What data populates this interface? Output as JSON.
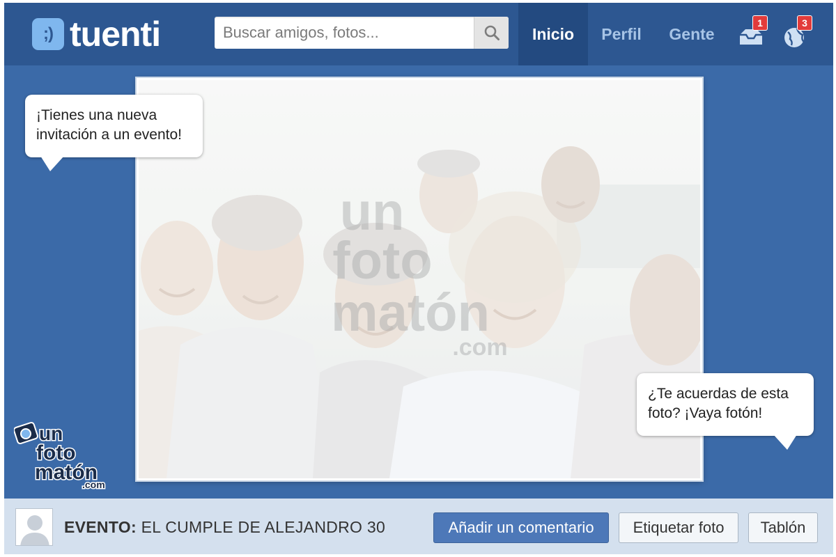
{
  "header": {
    "logo_text": "tuenti",
    "logo_badge": ";)",
    "search_placeholder": "Buscar amigos, fotos...",
    "nav": [
      {
        "label": "Inicio",
        "active": true
      },
      {
        "label": "Perfil",
        "active": false
      },
      {
        "label": "Gente",
        "active": false
      }
    ],
    "notifications": {
      "messages_count": "1",
      "events_count": "3"
    }
  },
  "bubbles": {
    "left_line1": "¡Tienes una nueva",
    "left_line2": "invitación a un evento!",
    "right_line1": "¿Te acuerdas de esta",
    "right_line2": "foto? ¡Vaya fotón!"
  },
  "watermark": {
    "line1": "un",
    "line2": "foto",
    "line3": "matón",
    "line4": ".com"
  },
  "brand_logo": {
    "line1": "un",
    "line2": "foto",
    "line3": "matón",
    "line4": ".com"
  },
  "footer": {
    "event_label": "EVENTO:",
    "event_name": "EL CUMPLE DE ALEJANDRO 30",
    "buttons": {
      "comment": "Añadir un comentario",
      "tag": "Etiquetar foto",
      "wall": "Tablón"
    }
  },
  "colors": {
    "frame_blue": "#3b6aa8",
    "topbar_blue": "#2d5791",
    "active_nav": "#234a80",
    "badge_red": "#e23b3b",
    "bottom_bar": "#d4e0ee",
    "primary_button": "#4d78b8"
  }
}
